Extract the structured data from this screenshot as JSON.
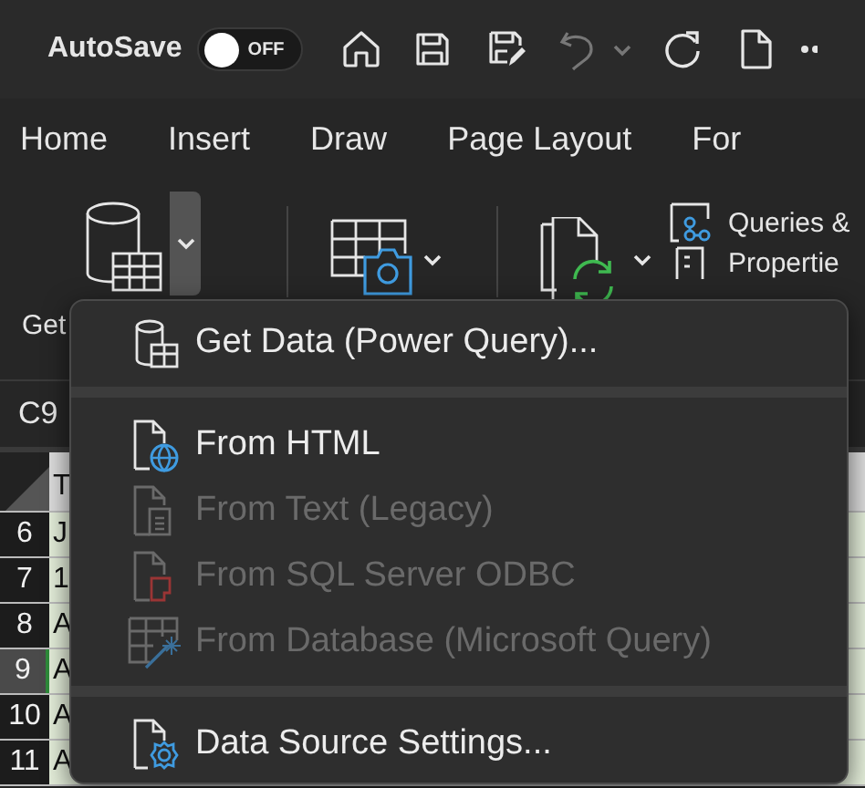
{
  "title_bar": {
    "autosave_label": "AutoSave",
    "autosave_toggle": {
      "on": false,
      "label": "OFF"
    }
  },
  "ribbon_tabs": [
    {
      "label": "Home",
      "selected": false
    },
    {
      "label": "Insert",
      "selected": false
    },
    {
      "label": "Draw",
      "selected": false
    },
    {
      "label": "Page Layout",
      "selected": false
    },
    {
      "label": "For",
      "selected": false
    }
  ],
  "ribbon": {
    "get_data_label": "Get",
    "queries_label": "Queries &",
    "properties_label": "Propertie"
  },
  "name_box": "C9",
  "grid": {
    "header_cell": "T",
    "rows": [
      {
        "number": "6",
        "cell": "J",
        "selected": false
      },
      {
        "number": "7",
        "cell": "1",
        "selected": false
      },
      {
        "number": "8",
        "cell": "A",
        "selected": false
      },
      {
        "number": "9",
        "cell": "A",
        "selected": true
      },
      {
        "number": "10",
        "cell": "A",
        "selected": false
      },
      {
        "number": "11",
        "cell": "A",
        "selected": false
      }
    ]
  },
  "menu": {
    "items": [
      {
        "kind": "item",
        "label": "Get Data (Power Query)...",
        "disabled": false
      },
      {
        "kind": "separator"
      },
      {
        "kind": "item",
        "label": "From HTML",
        "disabled": false
      },
      {
        "kind": "item",
        "label": "From Text (Legacy)",
        "disabled": true
      },
      {
        "kind": "item",
        "label": "From SQL Server ODBC",
        "disabled": true
      },
      {
        "kind": "item",
        "label": "From Database (Microsoft Query)",
        "disabled": true
      },
      {
        "kind": "separator"
      },
      {
        "kind": "item",
        "label": "Data Source Settings...",
        "disabled": false
      }
    ]
  }
}
